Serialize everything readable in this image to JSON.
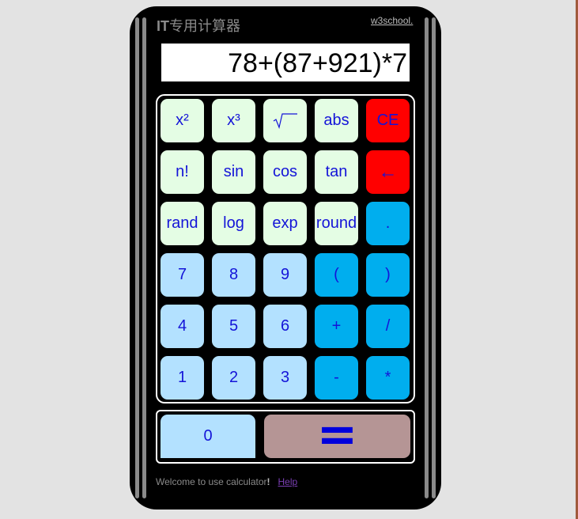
{
  "header": {
    "title_prefix": "IT",
    "title_rest": "专用计算器",
    "site_link": "w3school."
  },
  "display": {
    "value": "78+(87+921)*7"
  },
  "keys": {
    "square": "x²",
    "cube": "x³",
    "abs": "abs",
    "clear": "CE",
    "factorial": "n!",
    "sin": "sin",
    "cos": "cos",
    "tan": "tan",
    "backspace": "←",
    "rand": "rand",
    "log": "log",
    "exp": "exp",
    "round": "round",
    "dot": ".",
    "seven": "7",
    "eight": "8",
    "nine": "9",
    "lparen": "(",
    "rparen": ")",
    "four": "4",
    "five": "5",
    "six": "6",
    "plus": "+",
    "divide": "/",
    "one": "1",
    "two": "2",
    "three": "3",
    "minus": "-",
    "multiply": "*",
    "zero": "0",
    "equals": "="
  },
  "icons": {
    "sqrt": "sqrt-icon"
  },
  "footer": {
    "welcome": "Welcome to use calculator",
    "exclaim": "!",
    "help": "Help"
  },
  "colors": {
    "func_key": "#e4fde4",
    "num_key": "#b3e1ff",
    "op_key": "#00aeee",
    "danger_key": "#ff0000",
    "equals_key": "#b59595",
    "key_text": "#1414d8"
  }
}
